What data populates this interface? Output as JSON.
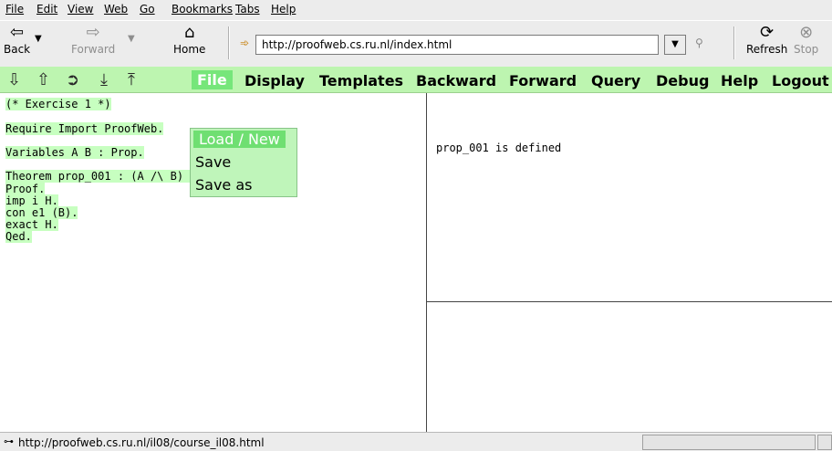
{
  "menu": [
    "File",
    "Edit",
    "View",
    "Web",
    "Go",
    "Bookmarks",
    "Tabs",
    "Help"
  ],
  "toolbar": {
    "back": "Back",
    "forward": "Forward",
    "home": "Home",
    "url": "http://proofweb.cs.ru.nl/index.html",
    "refresh": "Refresh",
    "stop": "Stop"
  },
  "app_menu": [
    "File",
    "Display",
    "Templates",
    "Backward",
    "Forward",
    "Query",
    "Debug",
    "Help",
    "Logout"
  ],
  "file_dropdown": [
    "Load / New",
    "Save",
    "Save as"
  ],
  "code": {
    "line1": "(* Exercise 1 *)",
    "line2": "Require Import ProofWeb.",
    "line3": "Variables A B : Prop.",
    "line4": "Theorem prop_001 : (A /\\ B) -> A.",
    "line5": "Proof.",
    "line6": "imp_i H.",
    "line7": "con_e1 (B).",
    "line8": "exact H.",
    "line9": "Qed."
  },
  "output": "prop_001 is defined",
  "status": "http://proofweb.cs.ru.nl/il08/course_il08.html"
}
